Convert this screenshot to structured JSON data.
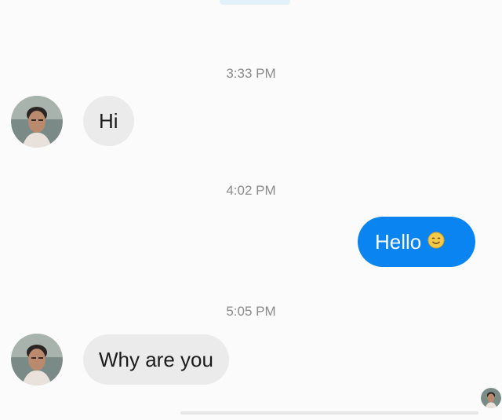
{
  "messages": [
    {
      "timestamp": "3:33 PM",
      "direction": "received",
      "text": "Hi"
    },
    {
      "timestamp": "4:02 PM",
      "direction": "sent",
      "text": "Hello",
      "emoji": "smiling-face-emoji"
    },
    {
      "timestamp": "5:05 PM",
      "direction": "received",
      "text": "Why are you"
    }
  ],
  "colors": {
    "sent_bubble": "#0a84f0",
    "received_bubble": "#ebebeb",
    "timestamp": "#8a8a8a"
  },
  "icons": {
    "avatar": "contact-avatar-photo",
    "seen_indicator": "seen-avatar-icon"
  }
}
